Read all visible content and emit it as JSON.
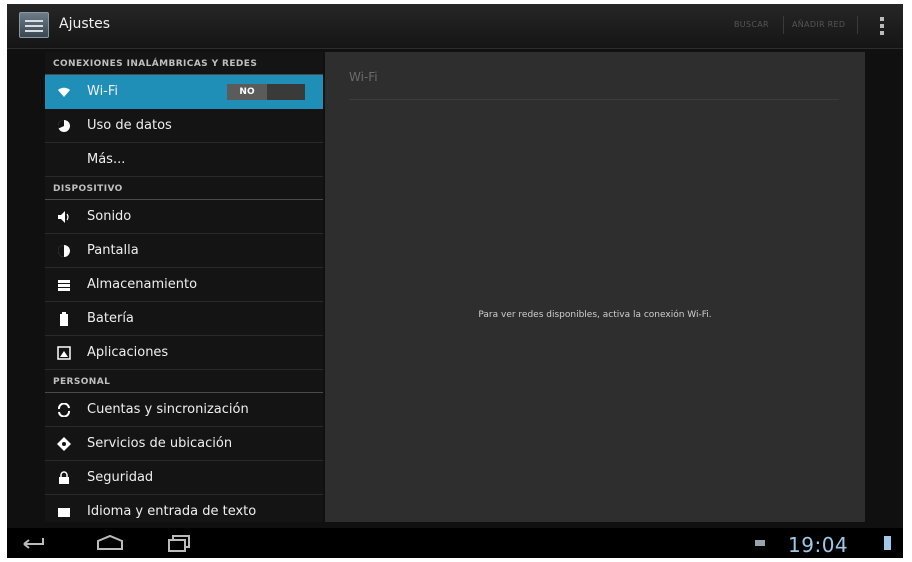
{
  "app": {
    "title": "Ajustes"
  },
  "actionbar": {
    "search": "BUSCAR",
    "add_network": "AÑADIR RED"
  },
  "sidebar": {
    "categories": [
      {
        "label": "CONEXIONES INALÁMBRICAS Y REDES"
      },
      {
        "label": "DISPOSITIVO"
      },
      {
        "label": "PERSONAL"
      }
    ],
    "items": [
      {
        "label": "Wi-Fi",
        "toggle": "NO"
      },
      {
        "label": "Uso de datos"
      },
      {
        "label": "Más..."
      },
      {
        "label": "Sonido"
      },
      {
        "label": "Pantalla"
      },
      {
        "label": "Almacenamiento"
      },
      {
        "label": "Batería"
      },
      {
        "label": "Aplicaciones"
      },
      {
        "label": "Cuentas y sincronización"
      },
      {
        "label": "Servicios de ubicación"
      },
      {
        "label": "Seguridad"
      },
      {
        "label": "Idioma y entrada de texto"
      }
    ]
  },
  "detail": {
    "title": "Wi-Fi",
    "message": "Para ver redes disponibles, activa la conexión Wi-Fi."
  },
  "statusbar": {
    "time": "19:04"
  },
  "colors": {
    "accent": "#1f8fb8",
    "clock": "#9fc9e6"
  }
}
